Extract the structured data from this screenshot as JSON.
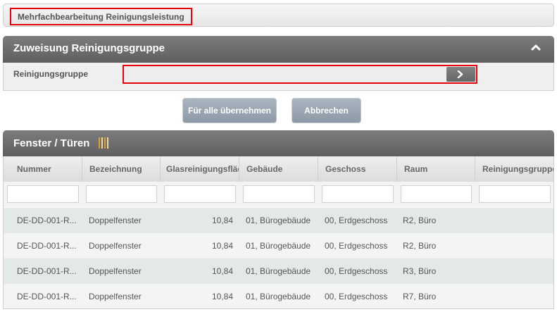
{
  "topbar": {
    "title": "Mehrfachbearbeitung Reinigungsleistung"
  },
  "assign_panel": {
    "title": "Zuweisung Reinigungsgruppe",
    "field_label": "Reinigungsgruppe",
    "field_value": ""
  },
  "actions": {
    "apply_label": "Für alle übernehmen",
    "cancel_label": "Abbrechen"
  },
  "grid": {
    "title": "Fenster / Türen",
    "columns": [
      "Nummer",
      "Bezeichnung",
      "Glasreinigungsfläche",
      "Gebäude",
      "Geschoss",
      "Raum",
      "Reinigungsgruppe"
    ],
    "rows": [
      [
        "DE-DD-001-R...",
        "Doppelfenster",
        "10,84",
        "01, Bürogebäude",
        "00, Erdgeschoss",
        "R2, Büro",
        ""
      ],
      [
        "DE-DD-001-R...",
        "Doppelfenster",
        "10,84",
        "01, Bürogebäude",
        "00, Erdgeschoss",
        "R2, Büro",
        ""
      ],
      [
        "DE-DD-001-R...",
        "Doppelfenster",
        "10,84",
        "01, Bürogebäude",
        "00, Erdgeschoss",
        "R3, Büro",
        ""
      ],
      [
        "DE-DD-001-R...",
        "Doppelfenster",
        "10,84",
        "01, Bürogebäude",
        "00, Erdgeschoss",
        "R7, Büro",
        ""
      ]
    ]
  },
  "colors": {
    "header_gray": "#6e6e6e",
    "highlight_red": "#e8000c",
    "button_blue_gray": "#9aa5b1",
    "row_alt": "#e3e8e8",
    "row_base": "#f3f5f5",
    "columns_icon": "#e0a030"
  },
  "icons": {
    "collapse": "chevron-up-icon",
    "open_picker": "chevron-right-icon",
    "columns": "column-chooser-icon"
  }
}
